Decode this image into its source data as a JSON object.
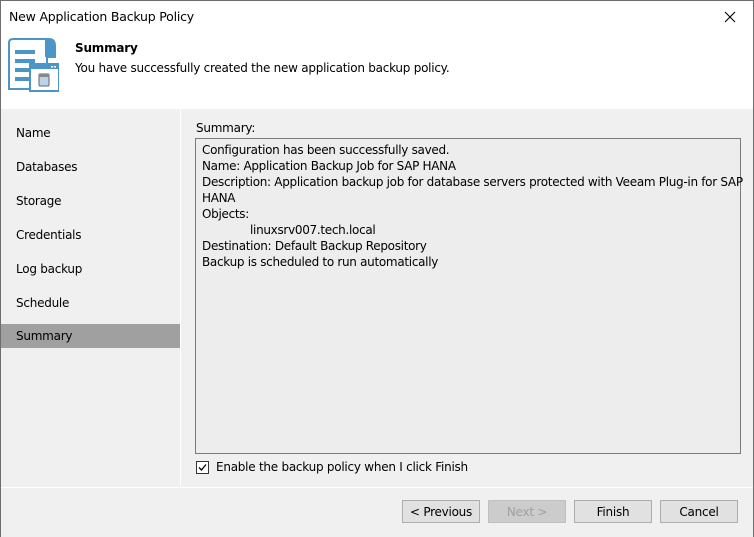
{
  "window": {
    "title": "New Application Backup Policy",
    "close_icon": "close-icon"
  },
  "header": {
    "icon": "policy-document-database-icon",
    "title": "Summary",
    "subtitle": "You have successfully created the new application backup policy."
  },
  "sidebar": {
    "items": [
      {
        "label": "Name",
        "active": false
      },
      {
        "label": "Databases",
        "active": false
      },
      {
        "label": "Storage",
        "active": false
      },
      {
        "label": "Credentials",
        "active": false
      },
      {
        "label": "Log backup",
        "active": false
      },
      {
        "label": "Schedule",
        "active": false
      },
      {
        "label": "Summary",
        "active": true
      }
    ]
  },
  "summary": {
    "label": "Summary:",
    "lines": [
      "Configuration has been successfully saved.",
      "Name: Application Backup Job for SAP HANA",
      "Description: Application backup job for database servers protected with Veeam Plug-in for SAP",
      "HANA",
      "Objects:",
      "linuxsrv007.tech.local",
      "Destination: Default Backup Repository",
      "Backup is scheduled to run automatically"
    ]
  },
  "enable_checkbox": {
    "label": "Enable the backup policy when I click Finish",
    "checked": true
  },
  "footer": {
    "previous": "< Previous",
    "next": "Next >",
    "finish": "Finish",
    "cancel": "Cancel"
  }
}
